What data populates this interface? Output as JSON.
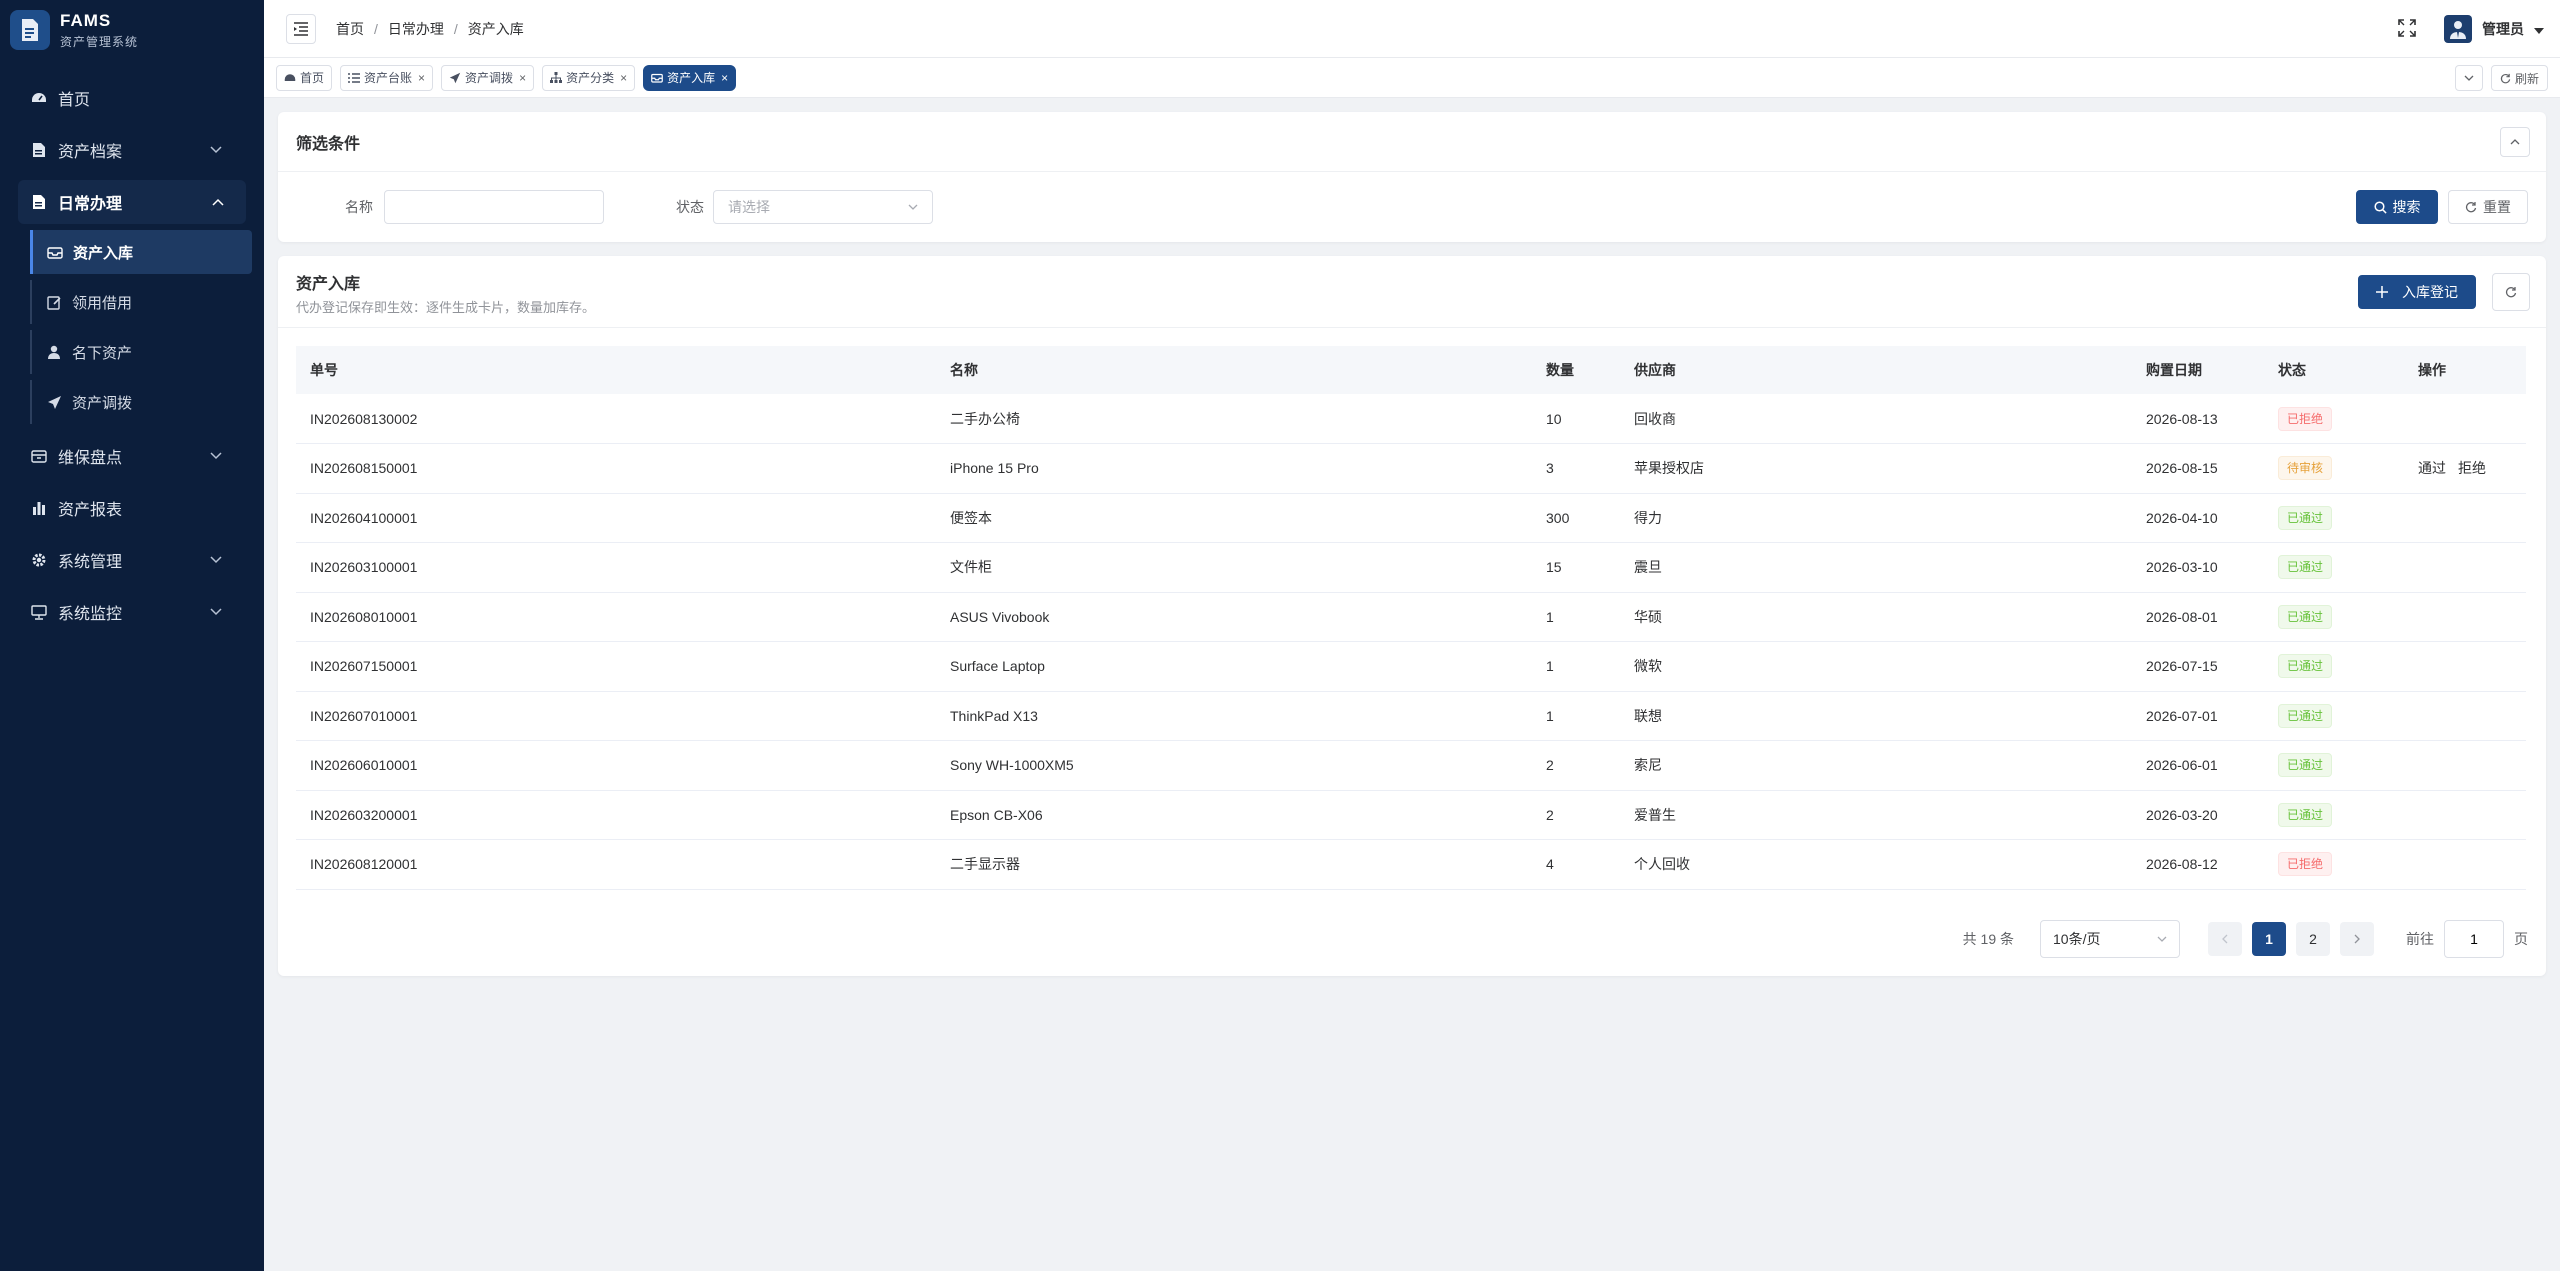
{
  "brand": {
    "title": "FAMS",
    "subtitle": "资产管理系统"
  },
  "sidebar": {
    "items": [
      {
        "label": "首页",
        "icon": "dashboard-icon"
      },
      {
        "label": "资产档案",
        "icon": "file-icon"
      },
      {
        "label": "日常办理",
        "icon": "file-icon"
      },
      {
        "label": "维保盘点",
        "icon": "box-icon"
      },
      {
        "label": "资产报表",
        "icon": "bar-chart-icon"
      },
      {
        "label": "系统管理",
        "icon": "gear-icon"
      },
      {
        "label": "系统监控",
        "icon": "monitor-icon"
      }
    ],
    "sub_items": [
      {
        "label": "资产入库",
        "icon": "inbox-icon"
      },
      {
        "label": "领用借用",
        "icon": "edit-icon"
      },
      {
        "label": "名下资产",
        "icon": "user-icon"
      },
      {
        "label": "资产调拨",
        "icon": "send-icon"
      }
    ]
  },
  "header": {
    "breadcrumb": [
      "首页",
      "日常办理",
      "资产入库"
    ],
    "user_name": "管理员"
  },
  "tags": [
    {
      "label": "首页"
    },
    {
      "label": "资产台账"
    },
    {
      "label": "资产调拨"
    },
    {
      "label": "资产分类"
    },
    {
      "label": "资产入库"
    }
  ],
  "tags_right": {
    "refresh_label": "刷新"
  },
  "filter": {
    "title": "筛选条件",
    "name_label": "名称",
    "name_value": "",
    "status_label": "状态",
    "status_placeholder": "请选择",
    "search_label": "搜索",
    "reset_label": "重置"
  },
  "table_card": {
    "title": "资产入库",
    "subtitle": "代办登记保存即生效：逐件生成卡片，数量加库存。",
    "add_label": "入库登记"
  },
  "table": {
    "columns": [
      "单号",
      "名称",
      "数量",
      "供应商",
      "购置日期",
      "状态",
      "操作"
    ],
    "rows": [
      {
        "no": "IN202608130002",
        "name": "二手办公椅",
        "qty": "10",
        "supplier": "回收商",
        "date": "2026-08-13",
        "status": "已拒绝"
      },
      {
        "no": "IN202608150001",
        "name": "iPhone 15 Pro",
        "qty": "3",
        "supplier": "苹果授权店",
        "date": "2026-08-15",
        "status": "待审核"
      },
      {
        "no": "IN202604100001",
        "name": "便签本",
        "qty": "300",
        "supplier": "得力",
        "date": "2026-04-10",
        "status": "已通过"
      },
      {
        "no": "IN202603100001",
        "name": "文件柜",
        "qty": "15",
        "supplier": "震旦",
        "date": "2026-03-10",
        "status": "已通过"
      },
      {
        "no": "IN202608010001",
        "name": "ASUS Vivobook",
        "qty": "1",
        "supplier": "华硕",
        "date": "2026-08-01",
        "status": "已通过"
      },
      {
        "no": "IN202607150001",
        "name": "Surface Laptop",
        "qty": "1",
        "supplier": "微软",
        "date": "2026-07-15",
        "status": "已通过"
      },
      {
        "no": "IN202607010001",
        "name": "ThinkPad X13",
        "qty": "1",
        "supplier": "联想",
        "date": "2026-07-01",
        "status": "已通过"
      },
      {
        "no": "IN202606010001",
        "name": "Sony WH-1000XM5",
        "qty": "2",
        "supplier": "索尼",
        "date": "2026-06-01",
        "status": "已通过"
      },
      {
        "no": "IN202603200001",
        "name": "Epson CB-X06",
        "qty": "2",
        "supplier": "爱普生",
        "date": "2026-03-20",
        "status": "已通过"
      },
      {
        "no": "IN202608120001",
        "name": "二手显示器",
        "qty": "4",
        "supplier": "个人回收",
        "date": "2026-08-12",
        "status": "已拒绝"
      }
    ],
    "actions": {
      "approve": "通过",
      "reject": "拒绝"
    }
  },
  "pager": {
    "total": "共 19 条",
    "page_size": "10条/页",
    "pages": [
      "1",
      "2"
    ],
    "goto_label": "前往",
    "goto_value": "1",
    "page_unit": "页"
  },
  "colors": {
    "sidebar_bg": "#0c1e3b",
    "primary": "#1d4b8a",
    "rejected": "#f56c6c",
    "pending": "#e6a23c",
    "passed": "#67c23a"
  }
}
